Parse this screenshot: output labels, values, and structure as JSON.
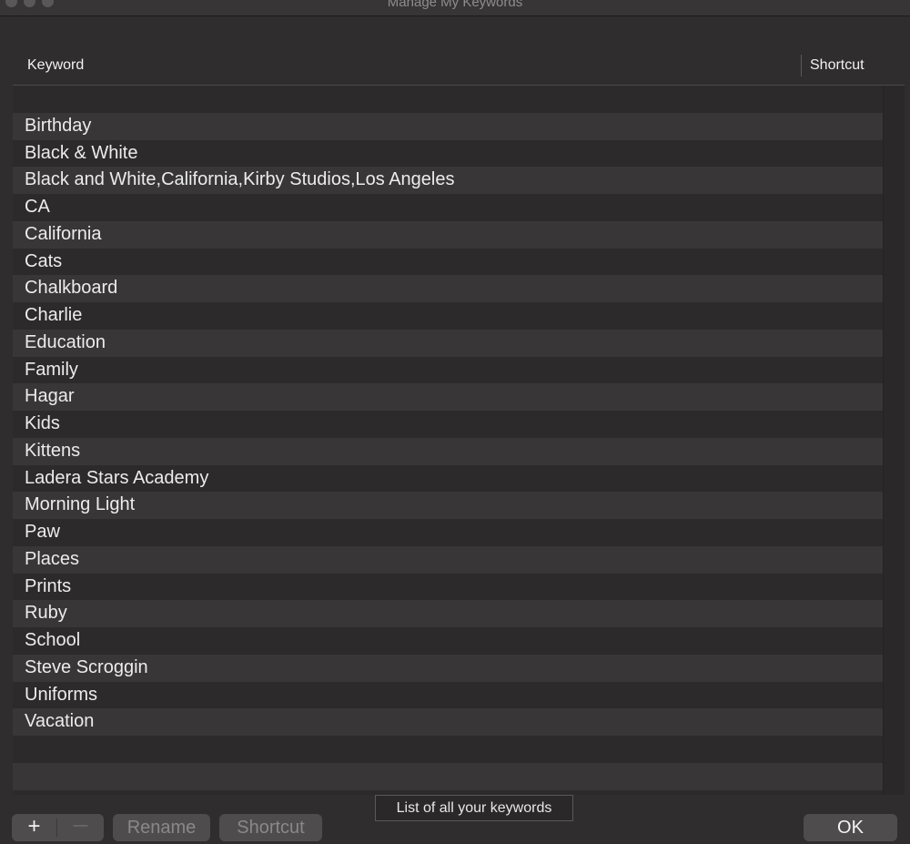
{
  "window": {
    "title": "Manage My Keywords"
  },
  "table": {
    "columns": {
      "keyword": "Keyword",
      "shortcut": "Shortcut"
    },
    "keywords": [
      "Birthday",
      "Black & White",
      "Black and White,California,Kirby Studios,Los Angeles",
      "CA",
      "California",
      "Cats",
      "Chalkboard",
      "Charlie",
      "Education",
      "Family",
      "Hagar",
      "Kids",
      "Kittens",
      "Ladera Stars Academy",
      "Morning Light",
      "Paw",
      "Places",
      "Prints",
      "Ruby",
      "School",
      "Steve Scroggin",
      "Uniforms",
      "Vacation"
    ]
  },
  "toolbar": {
    "add_label": "+",
    "remove_label": "—",
    "rename_label": "Rename",
    "shortcut_label": "Shortcut",
    "ok_label": "OK",
    "tooltip": "List of all your keywords"
  },
  "colors": {
    "background": "#2f2d2d",
    "row_odd": "#2c2a2a",
    "row_even": "#383636",
    "text": "#ececec",
    "disabled_text": "#8a8888",
    "button": "#4e4c4c"
  }
}
